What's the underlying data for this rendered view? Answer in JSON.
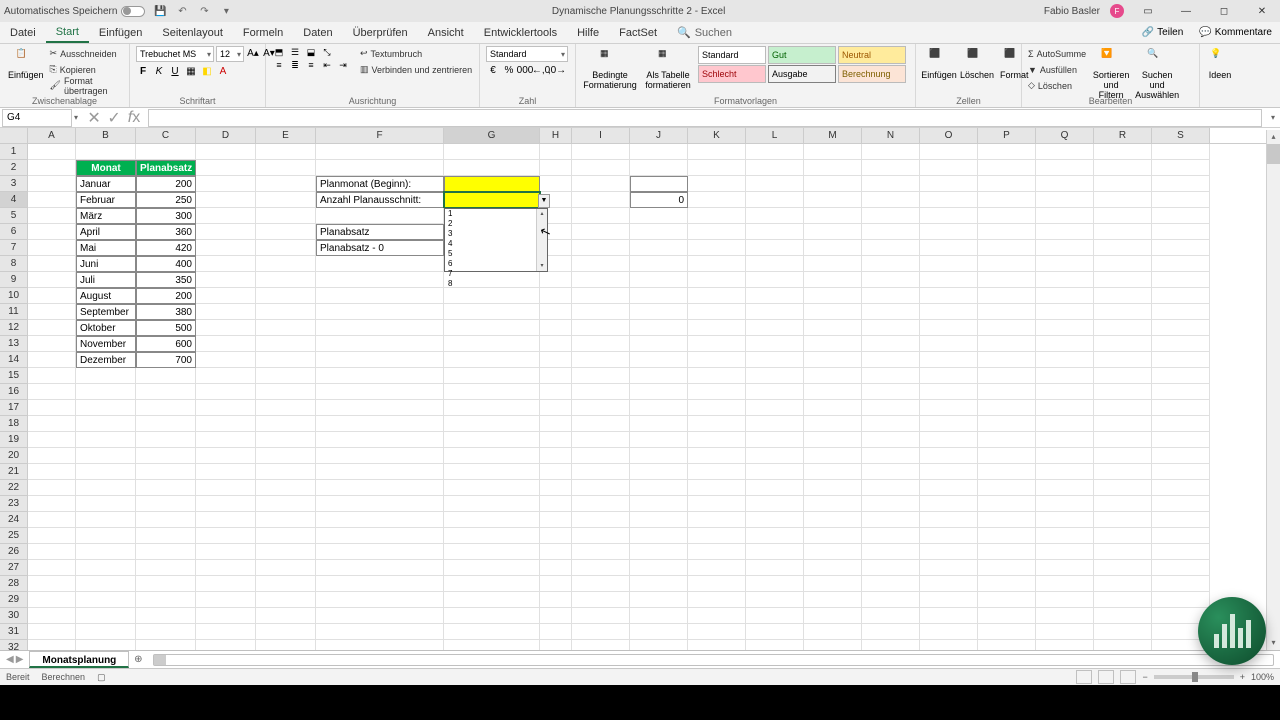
{
  "titlebar": {
    "autosave": "Automatisches Speichern",
    "doc_title": "Dynamische Planungsschritte 2  -  Excel",
    "user_name": "Fabio Basler",
    "user_initial": "F"
  },
  "tabs": {
    "datei": "Datei",
    "start": "Start",
    "einfuegen": "Einfügen",
    "seitenlayout": "Seitenlayout",
    "formeln": "Formeln",
    "daten": "Daten",
    "ueberpruefen": "Überprüfen",
    "ansicht": "Ansicht",
    "entwicklertools": "Entwicklertools",
    "hilfe": "Hilfe",
    "factset": "FactSet",
    "suchen": "Suchen",
    "teilen": "Teilen",
    "kommentare": "Kommentare"
  },
  "ribbon": {
    "paste": "Einfügen",
    "cut": "Ausschneiden",
    "copy": "Kopieren",
    "format_painter": "Format übertragen",
    "clipboard": "Zwischenablage",
    "font_name": "Trebuchet MS",
    "font_size": "12",
    "font_group": "Schriftart",
    "wrap": "Textumbruch",
    "merge": "Verbinden und zentrieren",
    "alignment": "Ausrichtung",
    "numfmt": "Standard",
    "number": "Zahl",
    "cond": "Bedingte Formatierung",
    "astable": "Als Tabelle formatieren",
    "st_standard": "Standard",
    "st_gut": "Gut",
    "st_neutral": "Neutral",
    "st_schlecht": "Schlecht",
    "st_ausgabe": "Ausgabe",
    "st_berechnung": "Berechnung",
    "styles": "Formatvorlagen",
    "insert": "Einfügen",
    "delete": "Löschen",
    "format": "Format",
    "cells": "Zellen",
    "autosum": "AutoSumme",
    "fill": "Ausfüllen",
    "clear": "Löschen",
    "sort": "Sortieren und Filtern",
    "find": "Suchen und Auswählen",
    "editing": "Bearbeiten",
    "ideas": "Ideen"
  },
  "namebox": "G4",
  "cols": [
    "A",
    "B",
    "C",
    "D",
    "E",
    "F",
    "G",
    "H",
    "I",
    "J",
    "K",
    "L",
    "M",
    "N",
    "O",
    "P",
    "Q",
    "R",
    "S"
  ],
  "table": {
    "hdr_monat": "Monat",
    "hdr_plan": "Planabsatz",
    "rows": [
      {
        "m": "Januar",
        "v": "200"
      },
      {
        "m": "Februar",
        "v": "250"
      },
      {
        "m": "März",
        "v": "300"
      },
      {
        "m": "April",
        "v": "360"
      },
      {
        "m": "Mai",
        "v": "420"
      },
      {
        "m": "Juni",
        "v": "400"
      },
      {
        "m": "Juli",
        "v": "350"
      },
      {
        "m": "August",
        "v": "200"
      },
      {
        "m": "September",
        "v": "380"
      },
      {
        "m": "Oktober",
        "v": "500"
      },
      {
        "m": "November",
        "v": "600"
      },
      {
        "m": "Dezember",
        "v": "700"
      }
    ]
  },
  "panel": {
    "planmonat": "Planmonat (Beginn):",
    "anzahl": "Anzahl Planausschnitt:",
    "planabsatz": "Planabsatz",
    "planabsatz0": "Planabsatz  - 0",
    "j4": "0"
  },
  "dropdown": {
    "items": [
      "1",
      "2",
      "3",
      "4",
      "5",
      "6",
      "7",
      "8"
    ]
  },
  "sheet": "Monatsplanung",
  "status": {
    "ready": "Bereit",
    "calc": "Berechnen",
    "zoom": "100%"
  }
}
